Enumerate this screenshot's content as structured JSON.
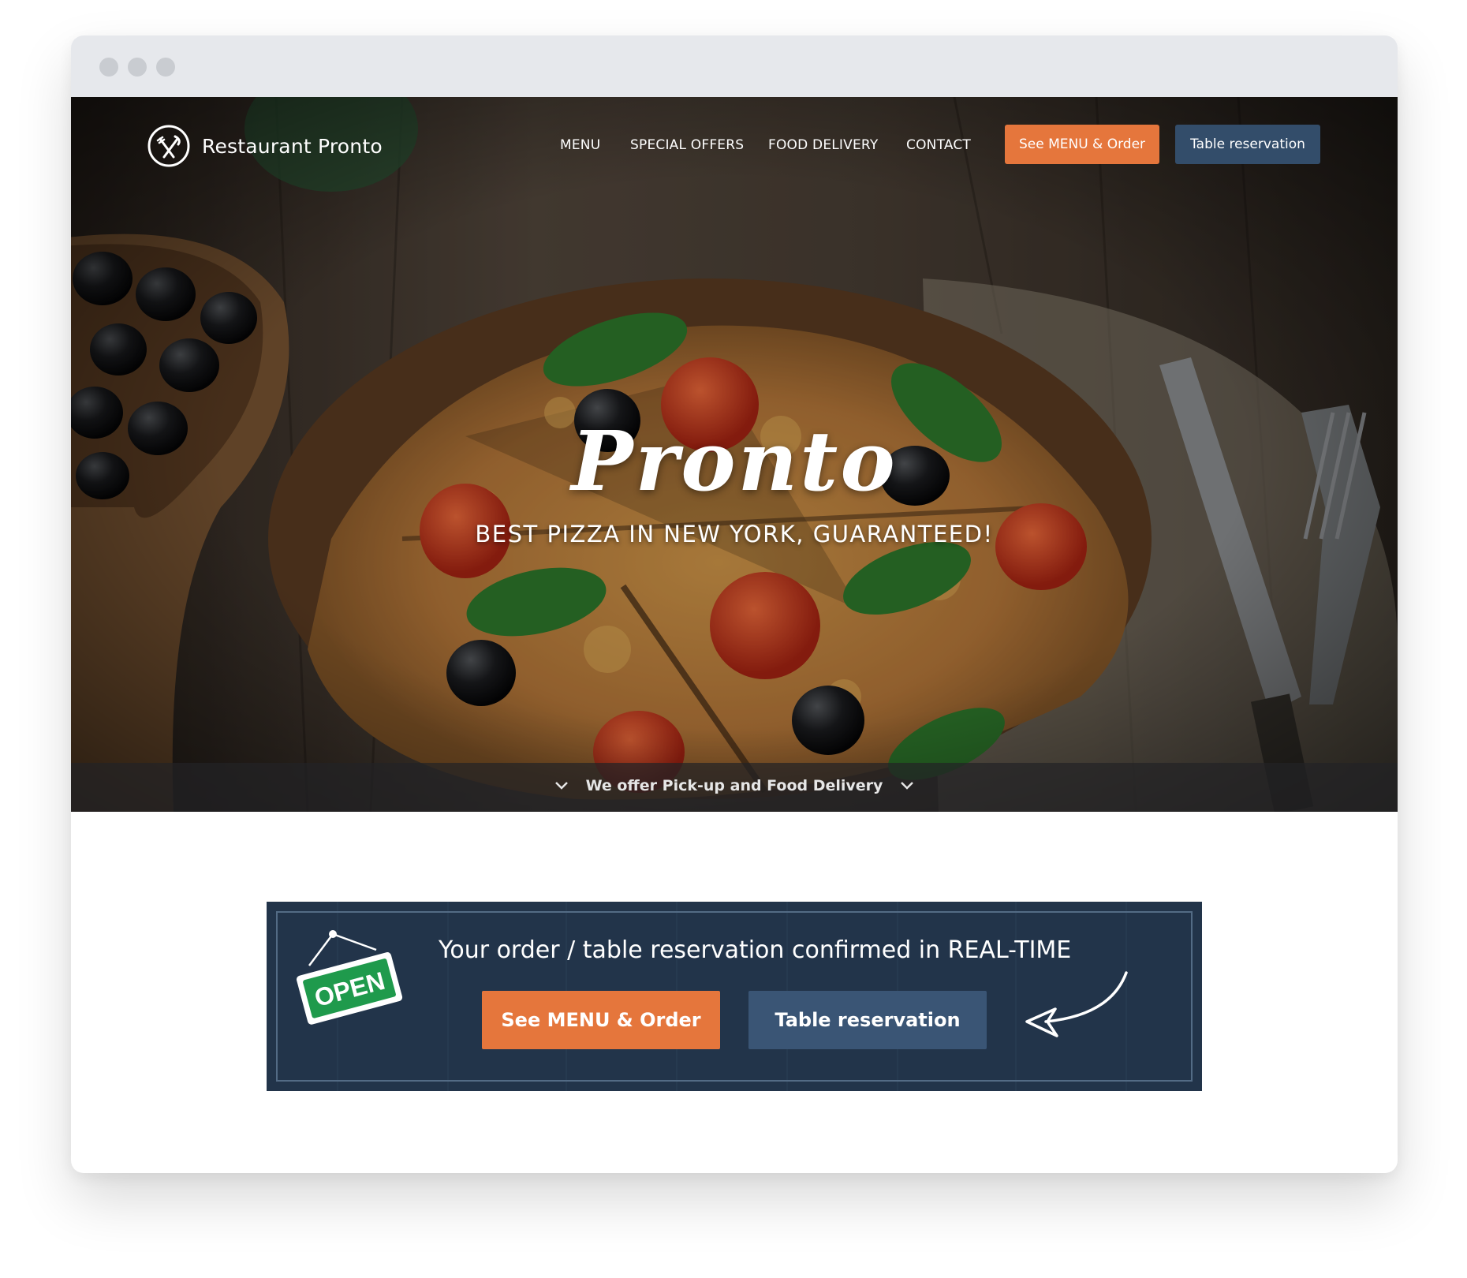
{
  "window": {
    "controls": [
      "close",
      "minimize",
      "maximize"
    ]
  },
  "header": {
    "logo_icon": "fork-knife-icon",
    "brand": "Restaurant Pronto",
    "nav": [
      {
        "label": "MENU"
      },
      {
        "label": "SPECIAL OFFERS"
      },
      {
        "label": "FOOD DELIVERY"
      },
      {
        "label": "CONTACT"
      }
    ],
    "order_button": "See MENU & Order",
    "reservation_button": "Table reservation"
  },
  "hero": {
    "title": "Pronto",
    "subtitle": "BEST PIZZA IN NEW YORK, GUARANTEED!",
    "strip_text": "We offer Pick-up and Food Delivery",
    "strip_icon": "chevron-down-icon"
  },
  "cta": {
    "sign_text": "OPEN",
    "title": "Your order / table reservation confirmed in REAL-TIME",
    "order_button": "See MENU & Order",
    "reservation_button": "Table reservation",
    "arrow_icon": "curved-arrow-icon"
  },
  "colors": {
    "accent_orange": "#e5763c",
    "navy_button": "#334d6a",
    "cta_background": "#22344a",
    "sign_green": "#1f9a4c"
  }
}
